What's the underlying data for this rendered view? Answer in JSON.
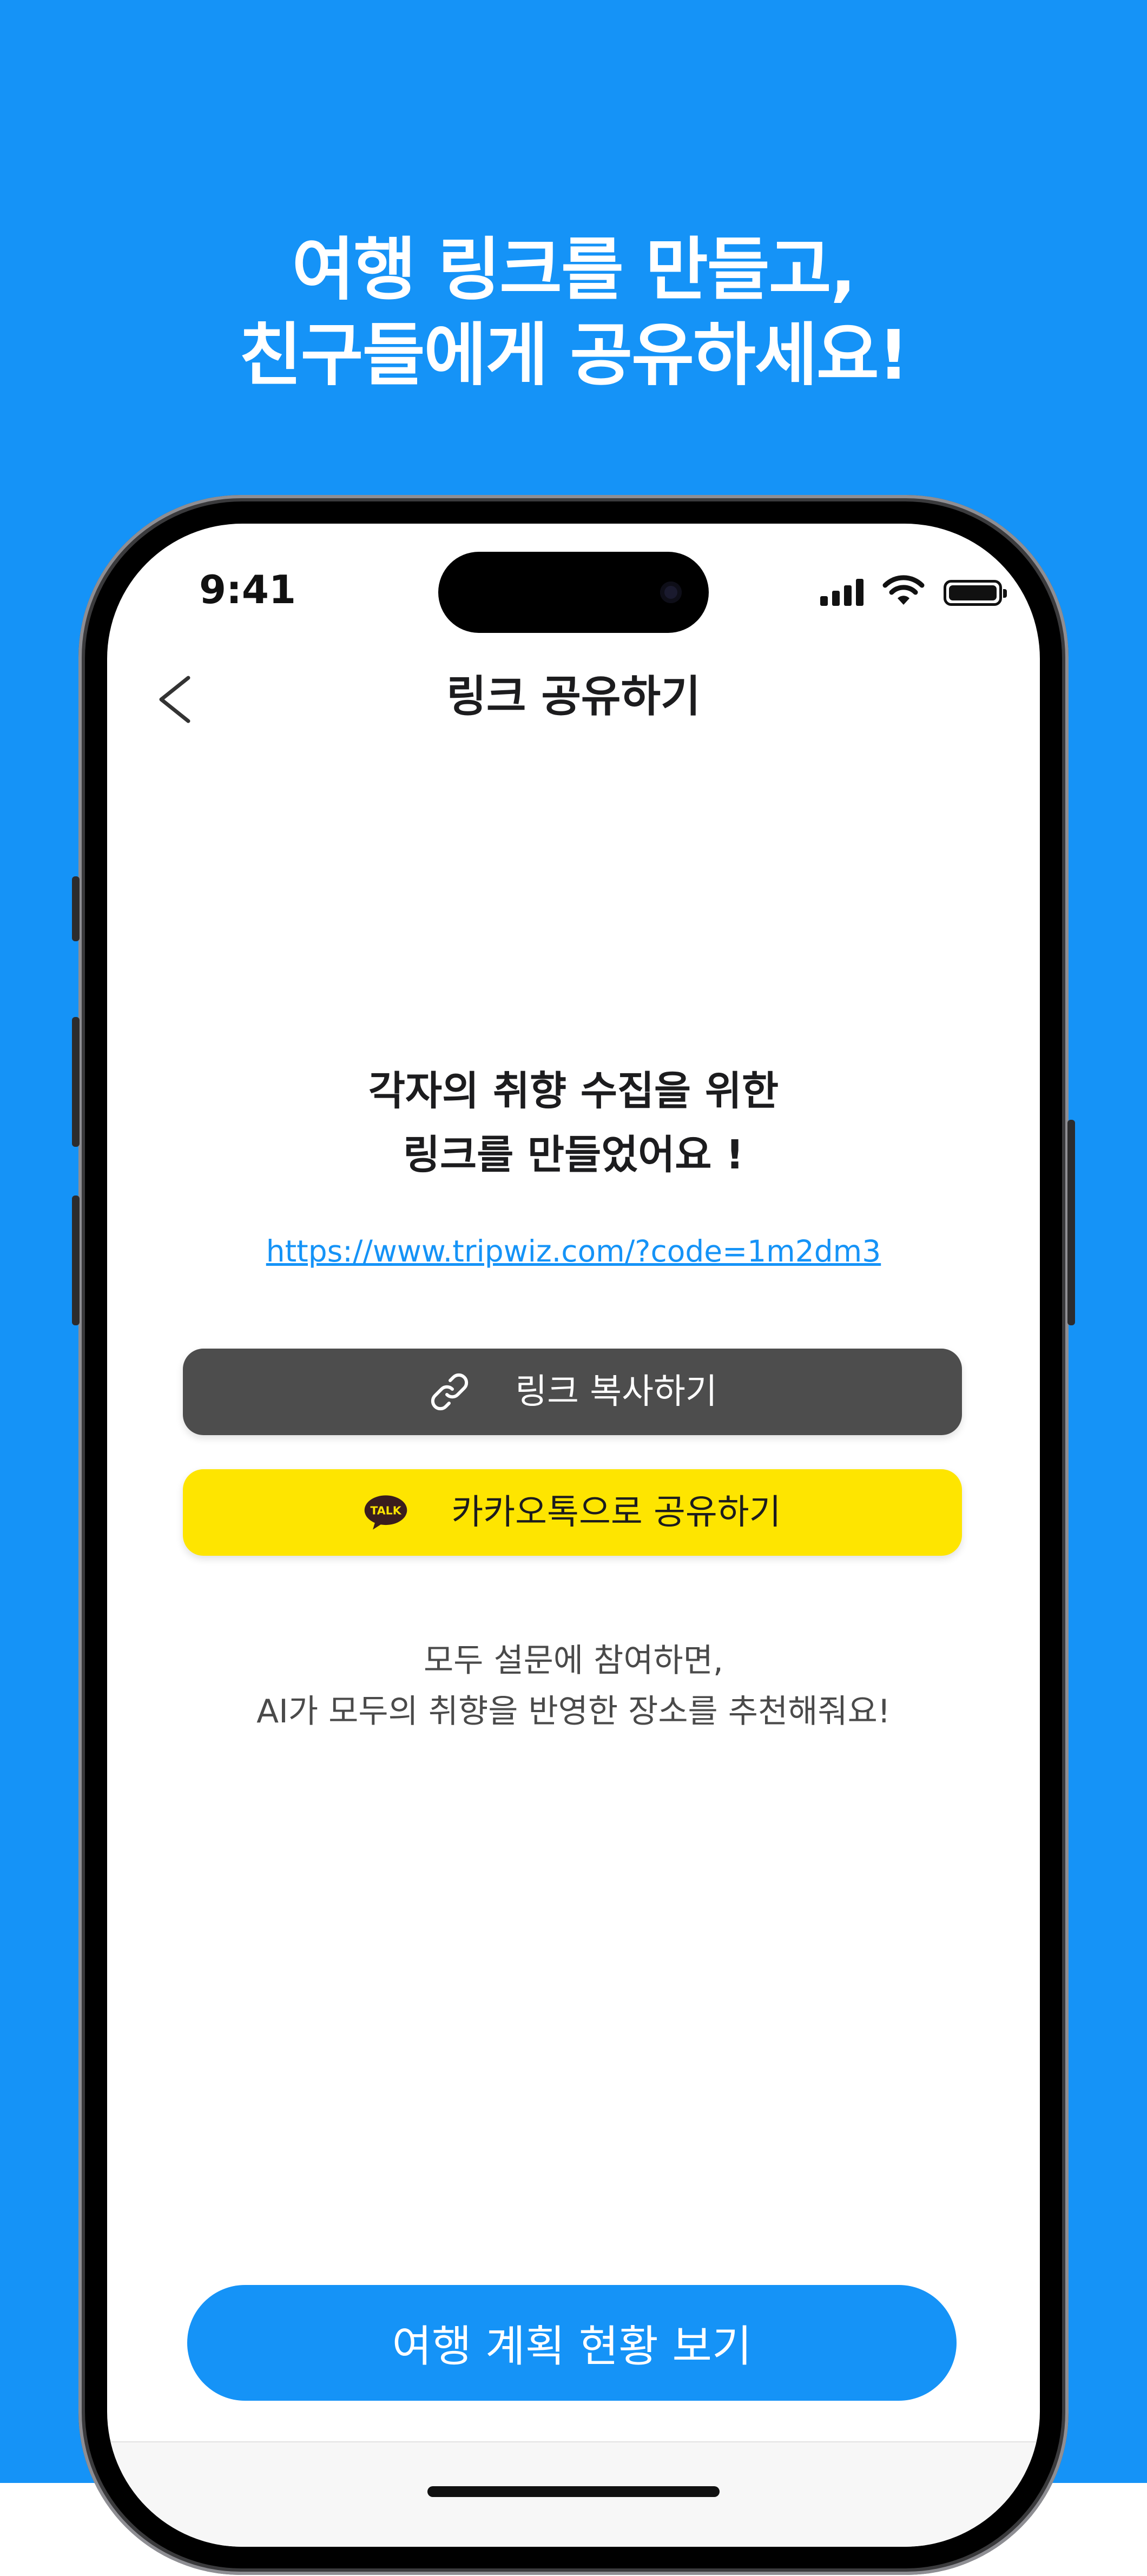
{
  "promo": {
    "headline_line1": "여행 링크를 만들고,",
    "headline_line2": "친구들에게 공유하세요!"
  },
  "status_bar": {
    "time": "9:41",
    "icons": [
      "cellular-signal-icon",
      "wifi-icon",
      "battery-icon"
    ]
  },
  "nav": {
    "back_icon": "chevron-left-icon",
    "title": "링크 공유하기"
  },
  "content": {
    "message_line1": "각자의 취향 수집을 위한",
    "message_line2": "링크를 만들었어요 !",
    "share_url": "https://www.tripwiz.com/?code=1m2dm3",
    "copy_button_label": "링크 복사하기",
    "copy_button_icon": "link-icon",
    "kakao_button_label": "카카오톡으로 공유하기",
    "kakao_button_icon": "kakao-talk-icon",
    "kakao_icon_text": "TALK",
    "note_line1": "모두 설문에 참여하면,",
    "note_line2": "AI가 모두의 취향을 반영한 장소를 추천해줘요!"
  },
  "cta": {
    "label": "여행 계획 현황 보기"
  },
  "colors": {
    "primary_blue": "#1593F7",
    "kakao_yellow": "#FEE500",
    "copy_button_gray": "#4D4D4D"
  }
}
